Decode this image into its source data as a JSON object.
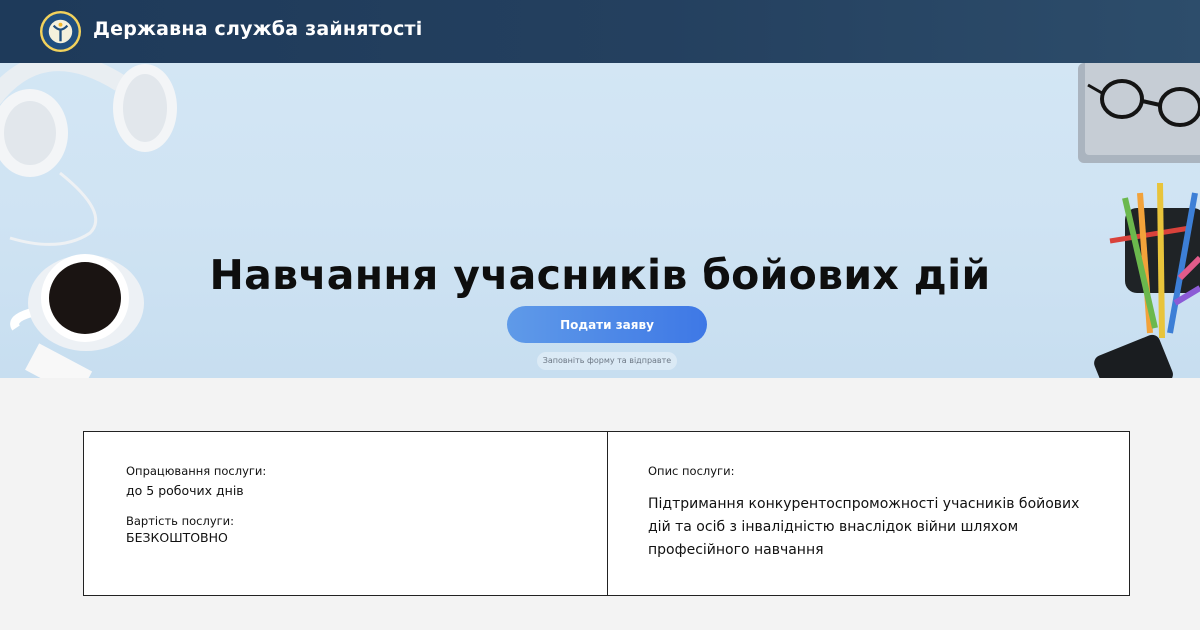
{
  "header": {
    "brand": "Державна служба зайнятості",
    "logo_icon": "employment-service-emblem"
  },
  "hero": {
    "title": "Навчання учасників бойових дій",
    "apply_button": "Подати заяву",
    "hint": "Заповніть форму та відправте"
  },
  "panel": {
    "processing_label": "Опрацювання послуги:",
    "processing_value": "до 5 робочих днів",
    "cost_label": "Вартість послуги:",
    "cost_value": "БЕЗКОШТОВНО",
    "description_label": "Опис послуги:",
    "description_text": "Підтримання конкурентоспроможності учасників бойових дій та осіб з інвалідністю внаслідок війни шляхом професійного навчання"
  },
  "colors": {
    "header_bg": "#1e3a5a",
    "hero_bg": "#d3e6f4",
    "button_bg": "#3e78e6",
    "page_bg": "#f3f3f3"
  }
}
